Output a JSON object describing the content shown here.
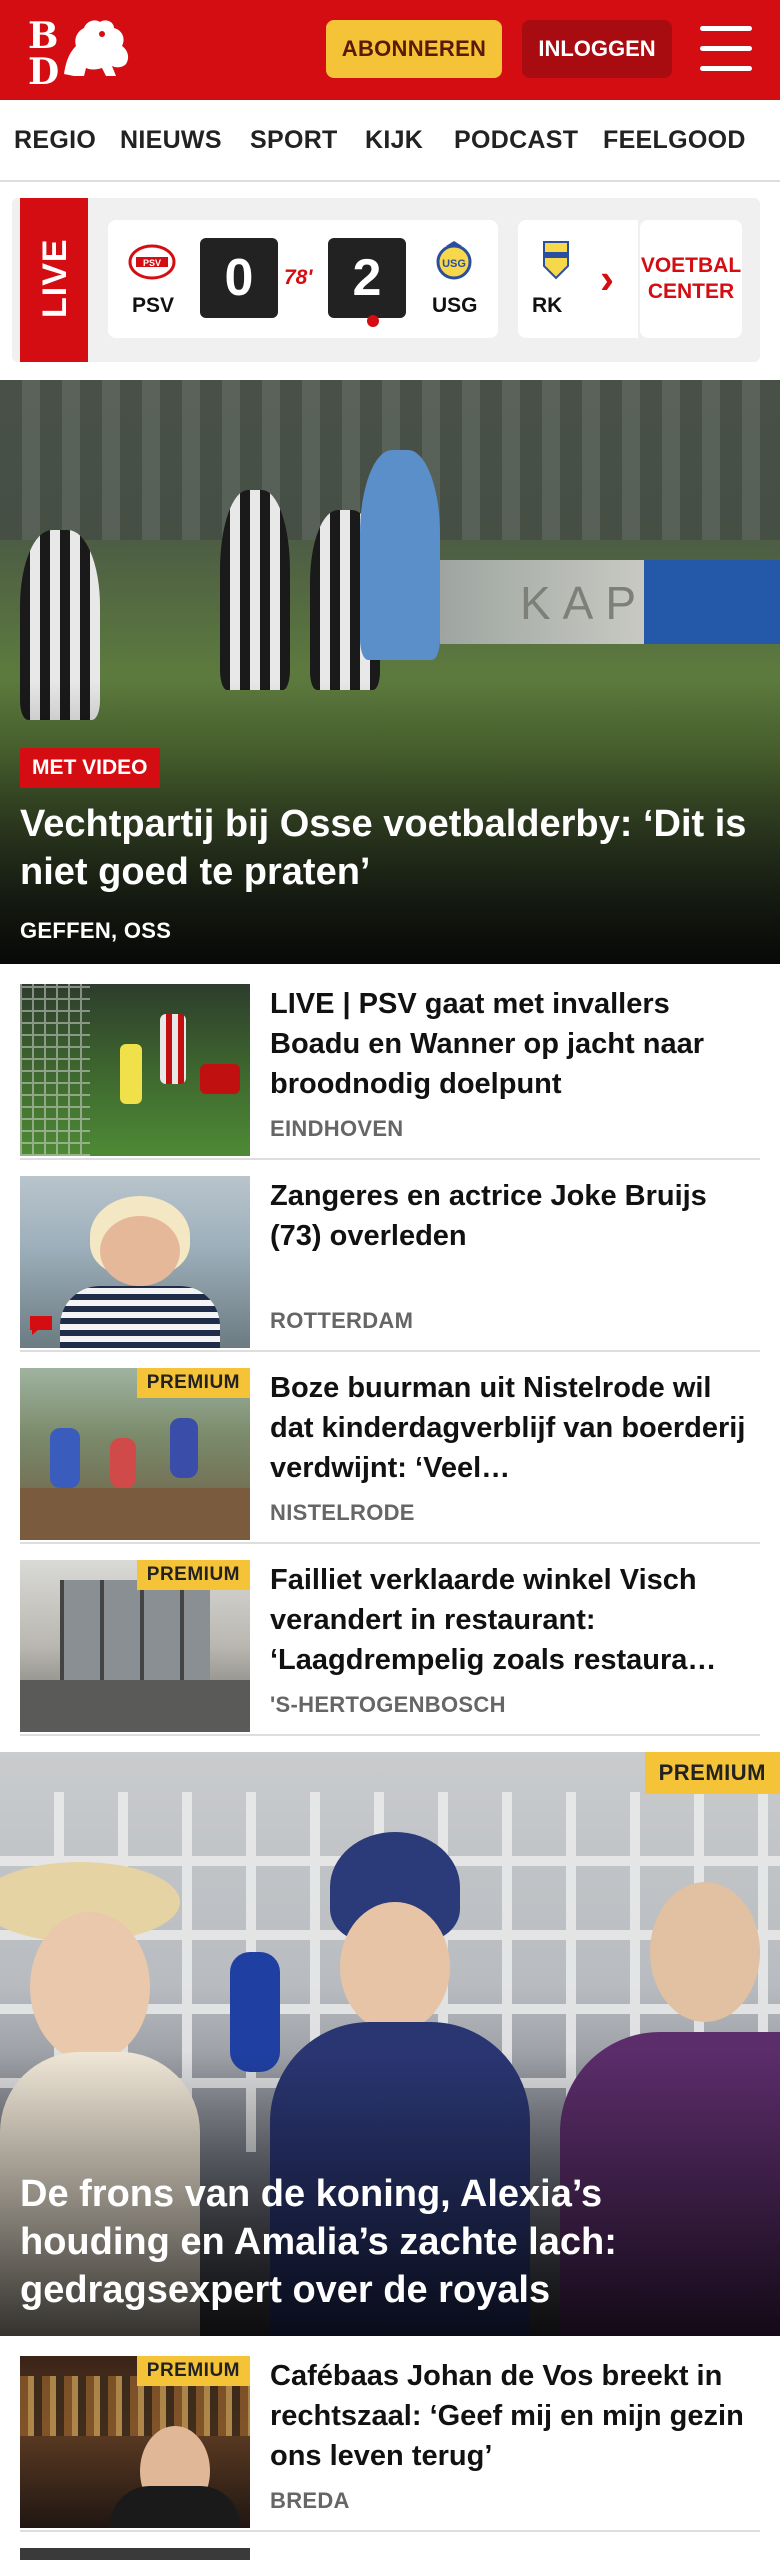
{
  "header": {
    "logo_b": "B",
    "logo_d": "D",
    "subscribe_label": "ABONNEREN",
    "login_label": "INLOGGEN",
    "brand_color": "#d40d12"
  },
  "nav": {
    "items": [
      "REGIO",
      "NIEUWS",
      "SPORT",
      "KIJK",
      "PODCAST",
      "FEELGOOD"
    ]
  },
  "live": {
    "tag": "LIVE",
    "match": {
      "home": "PSV",
      "away": "USG",
      "home_score": "0",
      "away_score": "2",
      "minute": "78'"
    },
    "next_team": "RK",
    "center_label": "VOETBAL CENTER"
  },
  "hero": {
    "badge": "MET VIDEO",
    "title": "Vechtpartij bij Osse voetbalderby: ‘Dit is niet goed te praten’",
    "location": "GEFFEN, OSS",
    "banner_text": "KAP"
  },
  "articles": [
    {
      "title": "LIVE | PSV gaat met invallers Boadu en Wanner op jacht naar broodnodig doelpunt",
      "location": "EINDHOVEN",
      "premium": ""
    },
    {
      "title": "Zangeres en actrice Joke Bruijs (73) overleden",
      "location": "ROTTERDAM",
      "premium": ""
    },
    {
      "title": "Boze buurman uit Nistelrode wil dat kinderdagverblijf van boerderij verdwijnt: ‘Veel…",
      "location": "NISTELRODE",
      "premium": "PREMIUM"
    },
    {
      "title": "Failliet verklaarde winkel Visch verandert in restaurant: ‘Laagdrempelig zoals restaura…",
      "location": "'S-HERTOGENBOSCH",
      "premium": "PREMIUM"
    }
  ],
  "feature": {
    "premium": "PREMIUM",
    "title": "De frons van de koning, Alexia’s houding en Amalia’s zachte lach: gedragsexpert over de royals"
  },
  "articles_bottom": [
    {
      "title": "Cafébaas Johan de Vos breekt in rechtszaal: ‘Geef mij en mijn gezin ons leven terug’",
      "location": "BREDA",
      "premium": "PREMIUM"
    }
  ]
}
